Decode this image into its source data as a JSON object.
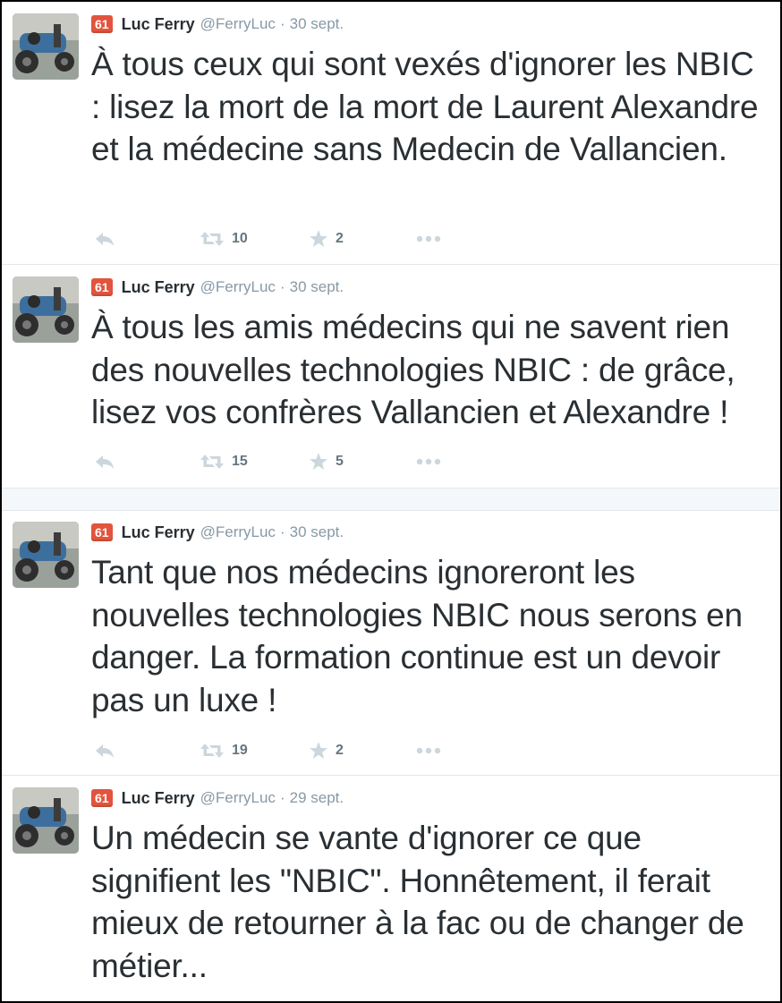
{
  "tweets": [
    {
      "badge": "61",
      "name": "Luc Ferry",
      "handle": "@FerryLuc",
      "separator": "·",
      "date": "30 sept.",
      "text": "À tous ceux qui sont vexés d'ignorer les NBIC : lisez la mort de la mort de Laurent Alexandre et la médecine sans Medecin de Vallancien.",
      "retweets": "10",
      "favorites": "2"
    },
    {
      "badge": "61",
      "name": "Luc Ferry",
      "handle": "@FerryLuc",
      "separator": "·",
      "date": "30 sept.",
      "text": "À tous les amis médecins qui ne savent rien des nouvelles technologies NBIC : de grâce, lisez vos confrères Vallancien et Alexandre !",
      "retweets": "15",
      "favorites": "5"
    },
    {
      "badge": "61",
      "name": "Luc Ferry",
      "handle": "@FerryLuc",
      "separator": "·",
      "date": "30 sept.",
      "text": "Tant que nos médecins ignoreront les nouvelles technologies NBIC  nous serons en danger. La formation continue est un devoir pas un luxe !",
      "retweets": "19",
      "favorites": "2"
    },
    {
      "badge": "61",
      "name": "Luc Ferry",
      "handle": "@FerryLuc",
      "separator": "·",
      "date": "29 sept.",
      "text": "Un médecin se vante d'ignorer ce que signifient les \"NBIC\". Honnêtement, il ferait mieux de retourner à la fac ou  de changer de métier...",
      "retweets": "",
      "favorites": ""
    }
  ],
  "icons": {
    "reply": "reply-icon",
    "retweet": "retweet-icon",
    "favorite": "star-icon",
    "more": "more-icon"
  },
  "colors": {
    "badge": "#e2543d",
    "text": "#292f33",
    "muted": "#8899a6",
    "icon": "#ccd6dd",
    "divider": "#e1e8ed"
  }
}
